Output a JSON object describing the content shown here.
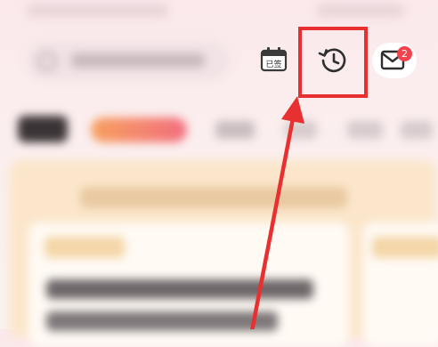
{
  "header": {
    "calendar_button": {
      "icon": "calendar-icon",
      "label": "已签"
    },
    "history_button": {
      "icon": "history-icon"
    },
    "mail_button": {
      "icon": "mail-icon",
      "badge": "2"
    }
  },
  "colors": {
    "highlight": "#e7302f",
    "badge": "#f2434d",
    "accent_tab": "#f26e7e"
  }
}
